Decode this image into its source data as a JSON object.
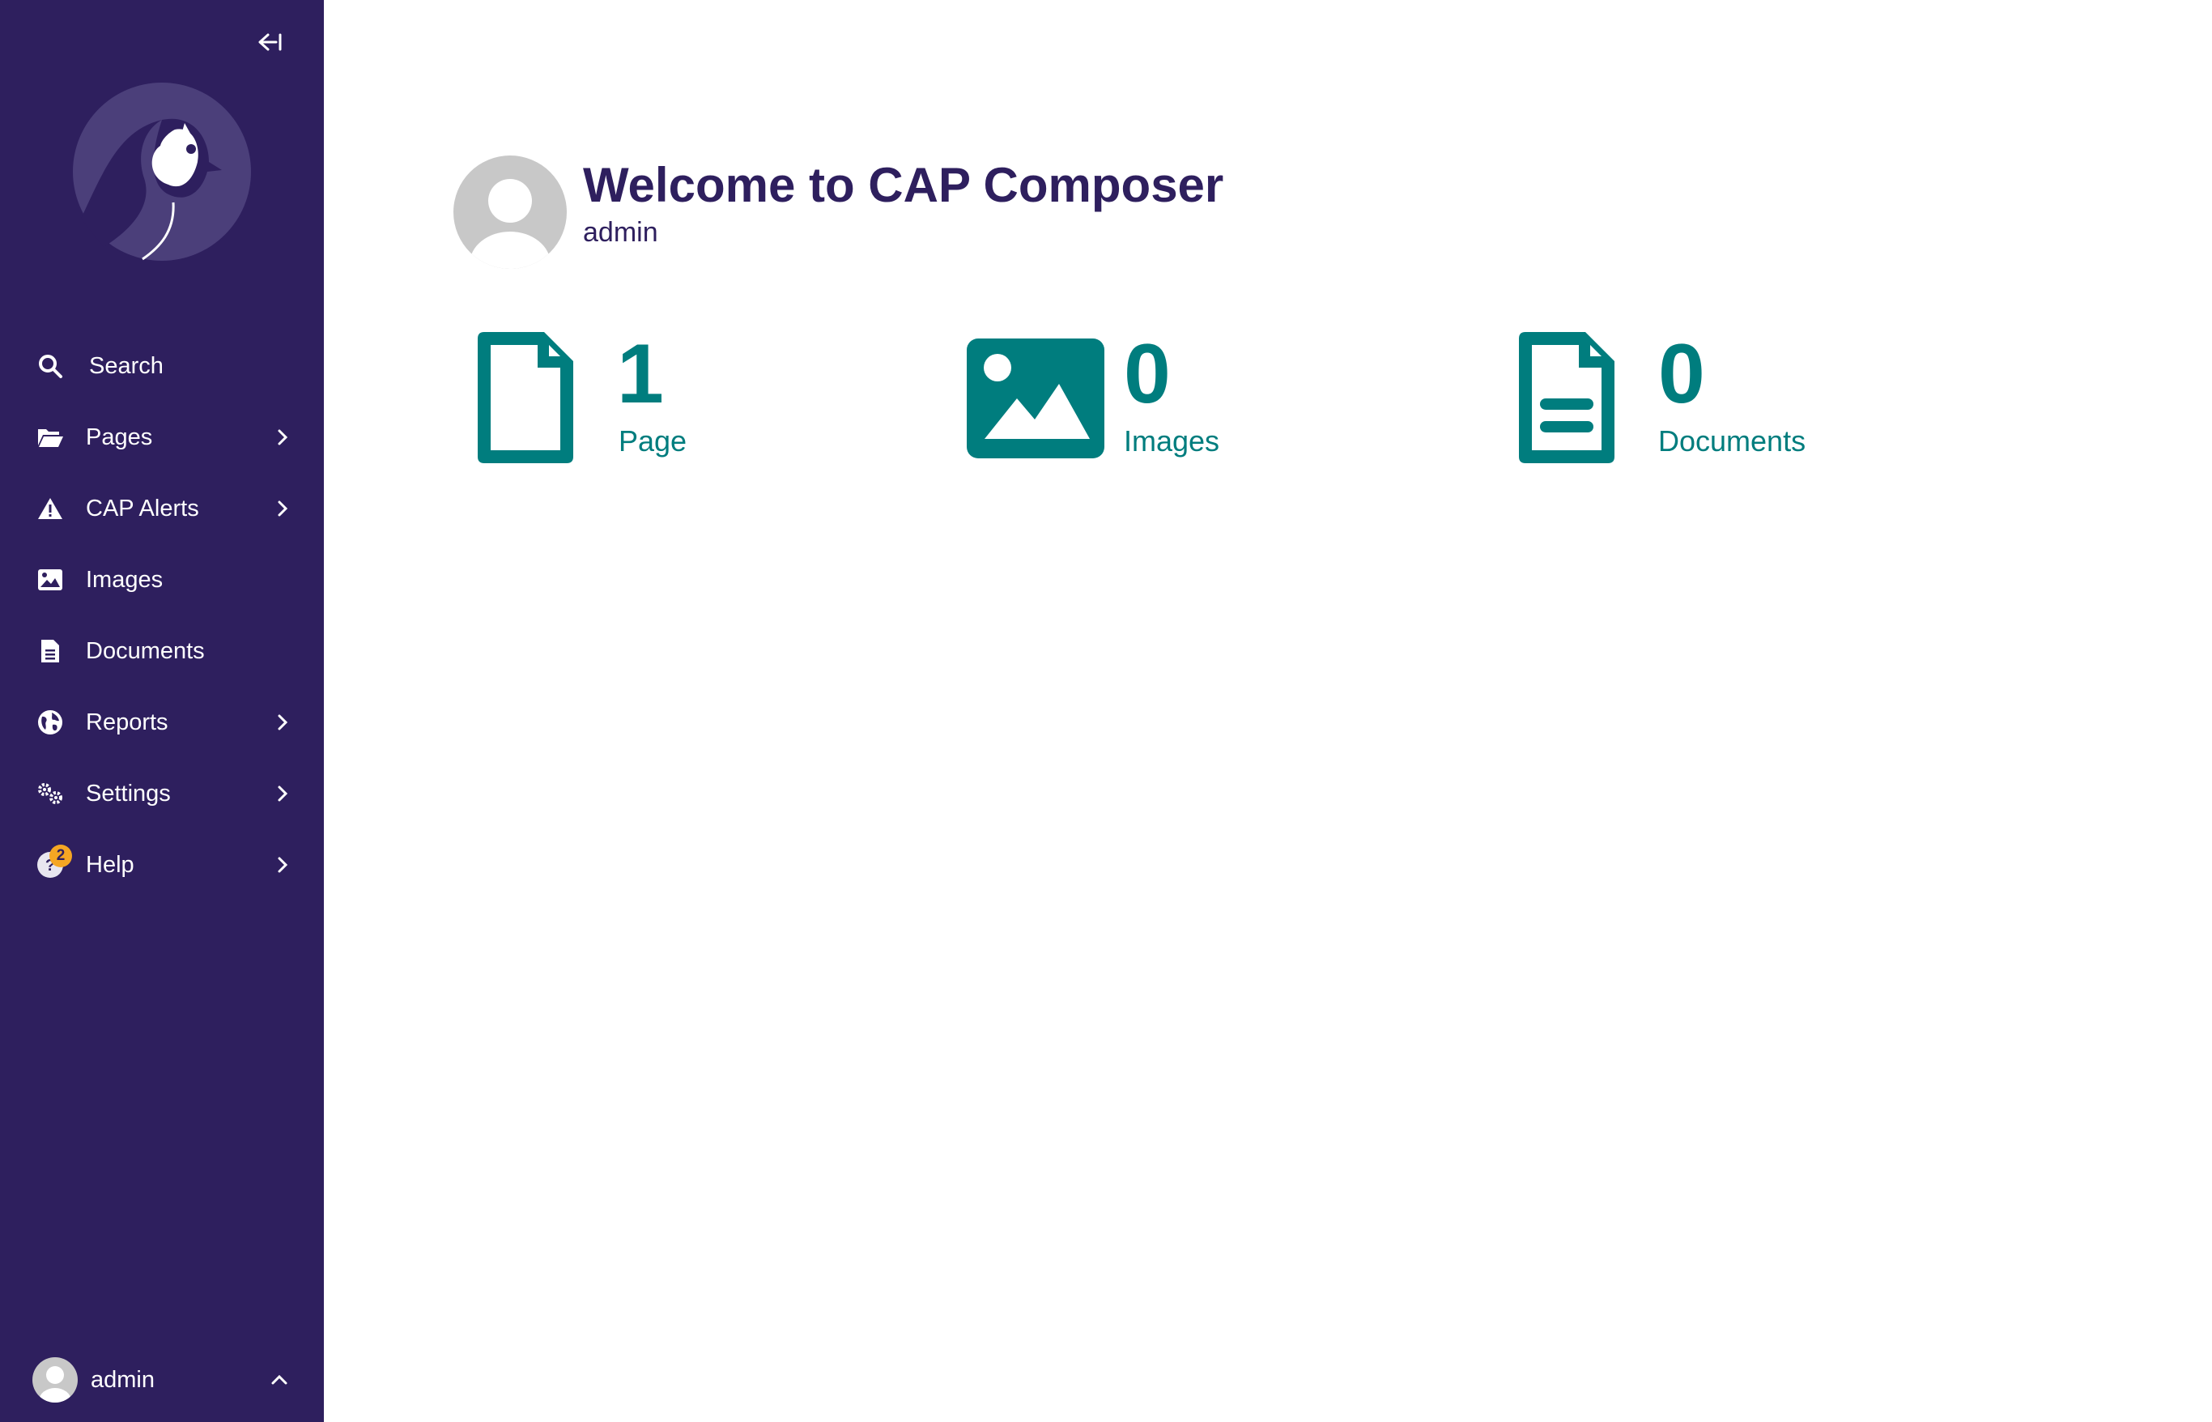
{
  "sidebar": {
    "collapse_icon": "arrow-left-bar-icon",
    "logo": "wagtail-bird-logo",
    "items": [
      {
        "label": "Search",
        "icon": "search-icon",
        "has_submenu": false
      },
      {
        "label": "Pages",
        "icon": "folder-open-icon",
        "has_submenu": true
      },
      {
        "label": "CAP Alerts",
        "icon": "warning-icon",
        "has_submenu": true
      },
      {
        "label": "Images",
        "icon": "image-icon",
        "has_submenu": false
      },
      {
        "label": "Documents",
        "icon": "document-icon",
        "has_submenu": false
      },
      {
        "label": "Reports",
        "icon": "globe-icon",
        "has_submenu": true
      },
      {
        "label": "Settings",
        "icon": "cogs-icon",
        "has_submenu": true
      },
      {
        "label": "Help",
        "icon": "help-icon",
        "has_submenu": true,
        "badge": "2"
      }
    ],
    "account": {
      "name": "admin",
      "icon": "chevron-up-icon"
    }
  },
  "welcome": {
    "title": "Welcome to CAP Composer",
    "user": "admin"
  },
  "stats": [
    {
      "count": "1",
      "label": "Page",
      "icon": "page-icon"
    },
    {
      "count": "0",
      "label": "Images",
      "icon": "image-icon"
    },
    {
      "count": "0",
      "label": "Documents",
      "icon": "document-icon"
    }
  ],
  "colors": {
    "sidebar_bg": "#2e1f5e",
    "accent": "#007d7e",
    "heading": "#2e1f5e",
    "badge": "#f5a623"
  }
}
